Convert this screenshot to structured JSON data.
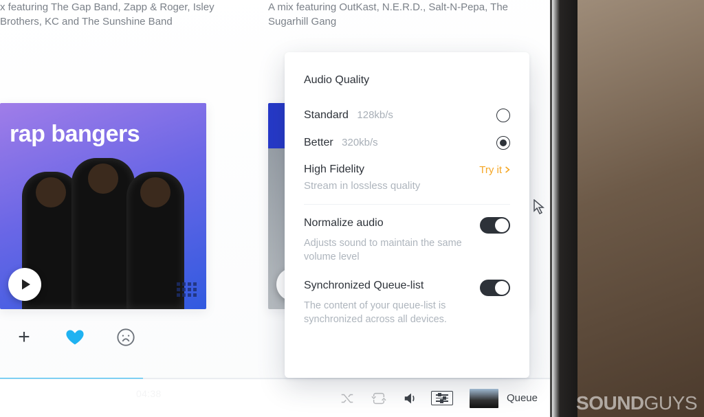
{
  "mixes": {
    "left": {
      "description": "x featuring The Gap Band, Zapp & Roger, Isley Brothers, KC and The Sunshine Band",
      "card_title": "rap bangers"
    },
    "right": {
      "description": "A mix featuring OutKast, N.E.R.D., Salt-N-Pepa, The Sugarhill Gang"
    }
  },
  "time_elapsed": "04:38",
  "settings_popover": {
    "heading": "Audio Quality",
    "options": [
      {
        "label": "Standard",
        "detail": "128kb/s",
        "selected": false
      },
      {
        "label": "Better",
        "detail": "320kb/s",
        "selected": true
      }
    ],
    "hifi": {
      "label": "High Fidelity",
      "cta": "Try it",
      "sub": "Stream in lossless quality"
    },
    "normalize": {
      "label": "Normalize audio",
      "desc": "Adjusts sound to maintain the same volume level",
      "enabled": true
    },
    "sync_queue": {
      "label": "Synchronized Queue-list",
      "desc": "The content of your queue-list is synchronized across all devices.",
      "enabled": true
    }
  },
  "bottom_bar": {
    "queue_label": "Queue"
  },
  "watermark": {
    "main": "SOUND",
    "suffix": "GUYS"
  }
}
